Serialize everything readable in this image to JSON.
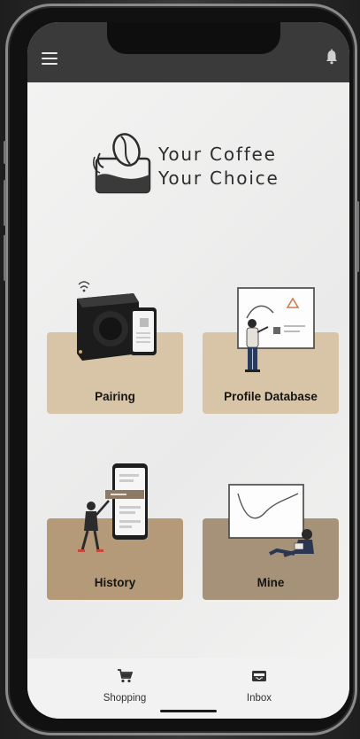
{
  "header": {
    "menu_icon": "hamburger-menu-icon",
    "notification_icon": "bell-icon"
  },
  "brand": {
    "line1": "Your Coffee",
    "line2": "Your Choice",
    "logo_icon": "coffee-bean-hand-logo"
  },
  "cards": [
    {
      "label": "Pairing",
      "color": "#d8c4a6",
      "illustration": "coffee-roaster-phone"
    },
    {
      "label": "Profile Database",
      "color": "#d8c4a6",
      "illustration": "presenter-whiteboard"
    },
    {
      "label": "History",
      "color": "#b49a78",
      "illustration": "woman-phone-list"
    },
    {
      "label": "Mine",
      "color": "#a69278",
      "illustration": "man-sitting-chart"
    }
  ],
  "bottom_nav": [
    {
      "label": "Shopping",
      "icon": "cart-icon"
    },
    {
      "label": "Inbox",
      "icon": "inbox-icon"
    }
  ],
  "colors": {
    "topbar": "#3a3a3a",
    "pad_light": "#d8c4a6",
    "pad_dark": "#a69278"
  }
}
